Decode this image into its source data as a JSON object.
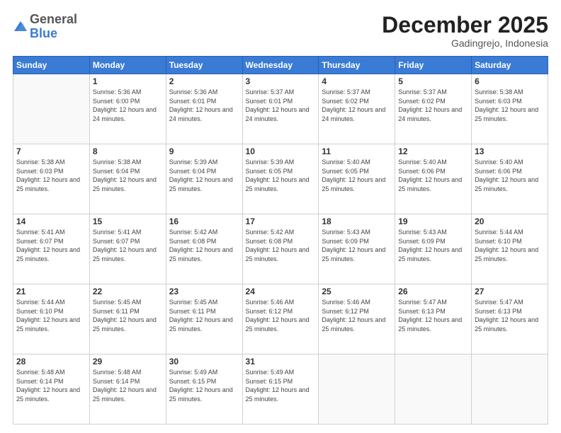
{
  "logo": {
    "general": "General",
    "blue": "Blue"
  },
  "header": {
    "month": "December 2025",
    "location": "Gadingrejo, Indonesia"
  },
  "weekdays": [
    "Sunday",
    "Monday",
    "Tuesday",
    "Wednesday",
    "Thursday",
    "Friday",
    "Saturday"
  ],
  "weeks": [
    [
      {
        "day": "",
        "sunrise": "",
        "sunset": "",
        "daylight": ""
      },
      {
        "day": "1",
        "sunrise": "Sunrise: 5:36 AM",
        "sunset": "Sunset: 6:00 PM",
        "daylight": "Daylight: 12 hours and 24 minutes."
      },
      {
        "day": "2",
        "sunrise": "Sunrise: 5:36 AM",
        "sunset": "Sunset: 6:01 PM",
        "daylight": "Daylight: 12 hours and 24 minutes."
      },
      {
        "day": "3",
        "sunrise": "Sunrise: 5:37 AM",
        "sunset": "Sunset: 6:01 PM",
        "daylight": "Daylight: 12 hours and 24 minutes."
      },
      {
        "day": "4",
        "sunrise": "Sunrise: 5:37 AM",
        "sunset": "Sunset: 6:02 PM",
        "daylight": "Daylight: 12 hours and 24 minutes."
      },
      {
        "day": "5",
        "sunrise": "Sunrise: 5:37 AM",
        "sunset": "Sunset: 6:02 PM",
        "daylight": "Daylight: 12 hours and 24 minutes."
      },
      {
        "day": "6",
        "sunrise": "Sunrise: 5:38 AM",
        "sunset": "Sunset: 6:03 PM",
        "daylight": "Daylight: 12 hours and 25 minutes."
      }
    ],
    [
      {
        "day": "7",
        "sunrise": "Sunrise: 5:38 AM",
        "sunset": "Sunset: 6:03 PM",
        "daylight": "Daylight: 12 hours and 25 minutes."
      },
      {
        "day": "8",
        "sunrise": "Sunrise: 5:38 AM",
        "sunset": "Sunset: 6:04 PM",
        "daylight": "Daylight: 12 hours and 25 minutes."
      },
      {
        "day": "9",
        "sunrise": "Sunrise: 5:39 AM",
        "sunset": "Sunset: 6:04 PM",
        "daylight": "Daylight: 12 hours and 25 minutes."
      },
      {
        "day": "10",
        "sunrise": "Sunrise: 5:39 AM",
        "sunset": "Sunset: 6:05 PM",
        "daylight": "Daylight: 12 hours and 25 minutes."
      },
      {
        "day": "11",
        "sunrise": "Sunrise: 5:40 AM",
        "sunset": "Sunset: 6:05 PM",
        "daylight": "Daylight: 12 hours and 25 minutes."
      },
      {
        "day": "12",
        "sunrise": "Sunrise: 5:40 AM",
        "sunset": "Sunset: 6:06 PM",
        "daylight": "Daylight: 12 hours and 25 minutes."
      },
      {
        "day": "13",
        "sunrise": "Sunrise: 5:40 AM",
        "sunset": "Sunset: 6:06 PM",
        "daylight": "Daylight: 12 hours and 25 minutes."
      }
    ],
    [
      {
        "day": "14",
        "sunrise": "Sunrise: 5:41 AM",
        "sunset": "Sunset: 6:07 PM",
        "daylight": "Daylight: 12 hours and 25 minutes."
      },
      {
        "day": "15",
        "sunrise": "Sunrise: 5:41 AM",
        "sunset": "Sunset: 6:07 PM",
        "daylight": "Daylight: 12 hours and 25 minutes."
      },
      {
        "day": "16",
        "sunrise": "Sunrise: 5:42 AM",
        "sunset": "Sunset: 6:08 PM",
        "daylight": "Daylight: 12 hours and 25 minutes."
      },
      {
        "day": "17",
        "sunrise": "Sunrise: 5:42 AM",
        "sunset": "Sunset: 6:08 PM",
        "daylight": "Daylight: 12 hours and 25 minutes."
      },
      {
        "day": "18",
        "sunrise": "Sunrise: 5:43 AM",
        "sunset": "Sunset: 6:09 PM",
        "daylight": "Daylight: 12 hours and 25 minutes."
      },
      {
        "day": "19",
        "sunrise": "Sunrise: 5:43 AM",
        "sunset": "Sunset: 6:09 PM",
        "daylight": "Daylight: 12 hours and 25 minutes."
      },
      {
        "day": "20",
        "sunrise": "Sunrise: 5:44 AM",
        "sunset": "Sunset: 6:10 PM",
        "daylight": "Daylight: 12 hours and 25 minutes."
      }
    ],
    [
      {
        "day": "21",
        "sunrise": "Sunrise: 5:44 AM",
        "sunset": "Sunset: 6:10 PM",
        "daylight": "Daylight: 12 hours and 25 minutes."
      },
      {
        "day": "22",
        "sunrise": "Sunrise: 5:45 AM",
        "sunset": "Sunset: 6:11 PM",
        "daylight": "Daylight: 12 hours and 25 minutes."
      },
      {
        "day": "23",
        "sunrise": "Sunrise: 5:45 AM",
        "sunset": "Sunset: 6:11 PM",
        "daylight": "Daylight: 12 hours and 25 minutes."
      },
      {
        "day": "24",
        "sunrise": "Sunrise: 5:46 AM",
        "sunset": "Sunset: 6:12 PM",
        "daylight": "Daylight: 12 hours and 25 minutes."
      },
      {
        "day": "25",
        "sunrise": "Sunrise: 5:46 AM",
        "sunset": "Sunset: 6:12 PM",
        "daylight": "Daylight: 12 hours and 25 minutes."
      },
      {
        "day": "26",
        "sunrise": "Sunrise: 5:47 AM",
        "sunset": "Sunset: 6:13 PM",
        "daylight": "Daylight: 12 hours and 25 minutes."
      },
      {
        "day": "27",
        "sunrise": "Sunrise: 5:47 AM",
        "sunset": "Sunset: 6:13 PM",
        "daylight": "Daylight: 12 hours and 25 minutes."
      }
    ],
    [
      {
        "day": "28",
        "sunrise": "Sunrise: 5:48 AM",
        "sunset": "Sunset: 6:14 PM",
        "daylight": "Daylight: 12 hours and 25 minutes."
      },
      {
        "day": "29",
        "sunrise": "Sunrise: 5:48 AM",
        "sunset": "Sunset: 6:14 PM",
        "daylight": "Daylight: 12 hours and 25 minutes."
      },
      {
        "day": "30",
        "sunrise": "Sunrise: 5:49 AM",
        "sunset": "Sunset: 6:15 PM",
        "daylight": "Daylight: 12 hours and 25 minutes."
      },
      {
        "day": "31",
        "sunrise": "Sunrise: 5:49 AM",
        "sunset": "Sunset: 6:15 PM",
        "daylight": "Daylight: 12 hours and 25 minutes."
      },
      {
        "day": "",
        "sunrise": "",
        "sunset": "",
        "daylight": ""
      },
      {
        "day": "",
        "sunrise": "",
        "sunset": "",
        "daylight": ""
      },
      {
        "day": "",
        "sunrise": "",
        "sunset": "",
        "daylight": ""
      }
    ]
  ]
}
